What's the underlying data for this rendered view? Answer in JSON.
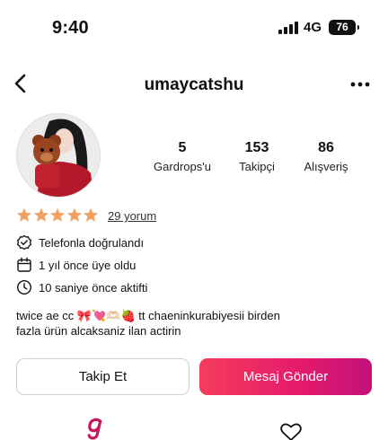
{
  "status": {
    "time": "9:40",
    "network": "4G",
    "battery": "76"
  },
  "header": {
    "username": "umaycatshu"
  },
  "stats": [
    {
      "value": "5",
      "label": "Gardrops'u"
    },
    {
      "value": "153",
      "label": "Takipçi"
    },
    {
      "value": "86",
      "label": "Alışveriş"
    }
  ],
  "rating": {
    "stars": 5,
    "reviews_label": "29 yorum",
    "star_color": "#f0a060"
  },
  "info": {
    "phone_verified": "Telefonla doğrulandı",
    "member_since": "1 yıl önce üye oldu",
    "last_active": "10 saniye önce aktifti"
  },
  "bio": {
    "line1": "twice ae cc 🎀💘🫶🏻🍓 tt chaeninkurabiyesii birden",
    "line2": "fazla ürün alcaksaniz ilan actirin"
  },
  "actions": {
    "follow": "Takip Et",
    "message": "Mesaj Gönder"
  },
  "icons": {
    "back": "chevron-left-icon",
    "more": "more-horizontal-icon",
    "verified": "verified-badge-icon",
    "calendar": "calendar-icon",
    "clock": "clock-icon",
    "home": "gardrops-logo-icon",
    "favorites": "heart-icon"
  },
  "colors": {
    "accent": "#e8196b",
    "brand_logo": "#c8185c"
  }
}
